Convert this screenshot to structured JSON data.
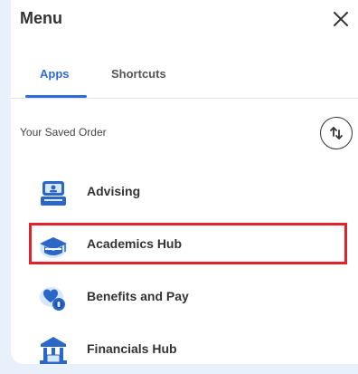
{
  "header": {
    "title": "Menu",
    "close_icon": "close-icon"
  },
  "tabs": [
    {
      "label": "Apps",
      "active": true
    },
    {
      "label": "Shortcuts",
      "active": false
    }
  ],
  "saved_order": {
    "label": "Your Saved Order",
    "sort_icon": "sort-arrows-icon"
  },
  "apps": [
    {
      "label": "Advising",
      "icon": "advising-icon"
    },
    {
      "label": "Academics Hub",
      "icon": "graduation-cap-icon",
      "highlighted": true
    },
    {
      "label": "Benefits and Pay",
      "icon": "benefits-icon"
    },
    {
      "label": "Financials Hub",
      "icon": "bank-icon"
    }
  ],
  "colors": {
    "accent": "#2e6bd8",
    "highlight": "#e0232b",
    "icon_primary": "#2b67c6",
    "icon_light": "#d9e7fa",
    "background": "#e8f0fb"
  }
}
